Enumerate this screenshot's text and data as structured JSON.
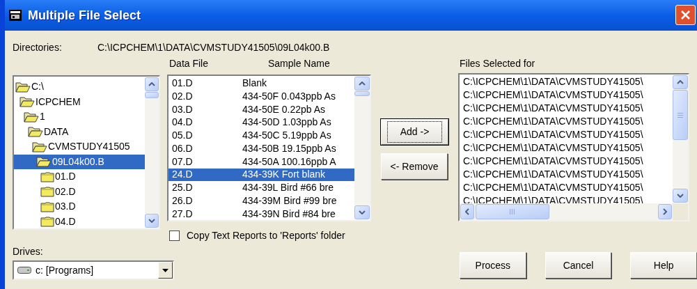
{
  "window": {
    "title": "Multiple File Select"
  },
  "directories": {
    "label": "Directories:",
    "path": "C:\\ICPCHEM\\1\\DATA\\CVMSTUDY41505\\09L04k00.B"
  },
  "tree": [
    {
      "label": "C:\\",
      "expanded": true,
      "selected": false,
      "children": [
        {
          "label": "ICPCHEM",
          "expanded": true,
          "selected": false,
          "children": [
            {
              "label": "1",
              "expanded": true,
              "selected": false,
              "children": [
                {
                  "label": "DATA",
                  "expanded": true,
                  "selected": false,
                  "children": [
                    {
                      "label": "CVMSTUDY41505",
                      "expanded": true,
                      "selected": false,
                      "children": [
                        {
                          "label": "09L04k00.B",
                          "expanded": true,
                          "selected": true,
                          "children": [
                            {
                              "label": "01.D",
                              "expanded": false,
                              "selected": false
                            },
                            {
                              "label": "02.D",
                              "expanded": false,
                              "selected": false
                            },
                            {
                              "label": "03.D",
                              "expanded": false,
                              "selected": false
                            },
                            {
                              "label": "04.D",
                              "expanded": false,
                              "selected": false
                            }
                          ]
                        }
                      ]
                    }
                  ]
                }
              ]
            }
          ]
        }
      ]
    }
  ],
  "drives": {
    "label": "Drives:",
    "value": "c: [Programs]"
  },
  "data_list": {
    "columns": [
      "Data File",
      "Sample Name"
    ],
    "rows": [
      {
        "data_file": "01.D",
        "sample_name": "Blank",
        "selected": false
      },
      {
        "data_file": "02.D",
        "sample_name": "434-50F 0.043ppb As",
        "selected": false
      },
      {
        "data_file": "03.D",
        "sample_name": "434-50E 0.22pb As",
        "selected": false
      },
      {
        "data_file": "04.D",
        "sample_name": "434-50D 1.03ppb As",
        "selected": false
      },
      {
        "data_file": "05.D",
        "sample_name": "434-50C 5.19ppb As",
        "selected": false
      },
      {
        "data_file": "06.D",
        "sample_name": "434-50B 19.15ppb As",
        "selected": false
      },
      {
        "data_file": "07.D",
        "sample_name": "434-50A 100.16ppb A",
        "selected": false
      },
      {
        "data_file": "24.D",
        "sample_name": "434-39K Fort blank",
        "selected": true
      },
      {
        "data_file": "25.D",
        "sample_name": "434-39L Bird #66 bre",
        "selected": false
      },
      {
        "data_file": "26.D",
        "sample_name": "434-39M Bird #99 bre",
        "selected": false
      },
      {
        "data_file": "27.D",
        "sample_name": "434-39N Bird #84 bre",
        "selected": false
      }
    ]
  },
  "copy_reports": {
    "label": "Copy Text Reports to 'Reports' folder",
    "checked": false
  },
  "transfer_buttons": [
    {
      "label": "Add ->",
      "focused": true
    },
    {
      "label": "<- Remove",
      "focused": false
    }
  ],
  "selected_files": {
    "label": "Files Selected for",
    "rows": [
      "C:\\ICPCHEM\\1\\DATA\\CVMSTUDY41505\\",
      "C:\\ICPCHEM\\1\\DATA\\CVMSTUDY41505\\",
      "C:\\ICPCHEM\\1\\DATA\\CVMSTUDY41505\\",
      "C:\\ICPCHEM\\1\\DATA\\CVMSTUDY41505\\",
      "C:\\ICPCHEM\\1\\DATA\\CVMSTUDY41505\\",
      "C:\\ICPCHEM\\1\\DATA\\CVMSTUDY41505\\",
      "C:\\ICPCHEM\\1\\DATA\\CVMSTUDY41505\\",
      "C:\\ICPCHEM\\1\\DATA\\CVMSTUDY41505\\",
      "C:\\ICPCHEM\\1\\DATA\\CVMSTUDY41505\\",
      "C:\\ICPCHEM\\1\\DATA\\CVMSTUDY41505\\"
    ]
  },
  "buttons": [
    "Process",
    "Cancel",
    "Help"
  ]
}
